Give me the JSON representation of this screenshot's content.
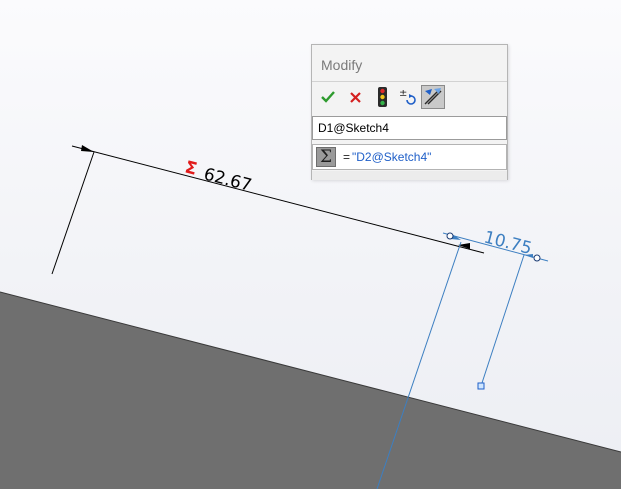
{
  "dialog": {
    "title": "Modify",
    "name_value": "D1@Sketch4",
    "equation_prefix": "=",
    "equation_value": "\"D2@Sketch4\"",
    "buttons": [
      {
        "name": "ok",
        "icon": "check-icon"
      },
      {
        "name": "cancel",
        "icon": "x-icon"
      },
      {
        "name": "rebuild",
        "icon": "traffic-light-icon"
      },
      {
        "name": "reverse-dimension",
        "icon": "plus-minus-arrow-icon"
      },
      {
        "name": "mark-for-drawing",
        "icon": "mark-dimension-icon"
      }
    ],
    "sigma_symbol": "Σ"
  },
  "sketch": {
    "driving_dimension": {
      "value": "62.67",
      "symbol": "Σ"
    },
    "selected_dimension": {
      "value": "10.75"
    }
  },
  "colors": {
    "dimension_text": "#000000",
    "equation_symbol": "#e11b1b",
    "selected": "#3d7fc1",
    "accept": "#2e9b2e",
    "cancel": "#d42020",
    "floor_surface": "#6f6f6f"
  }
}
